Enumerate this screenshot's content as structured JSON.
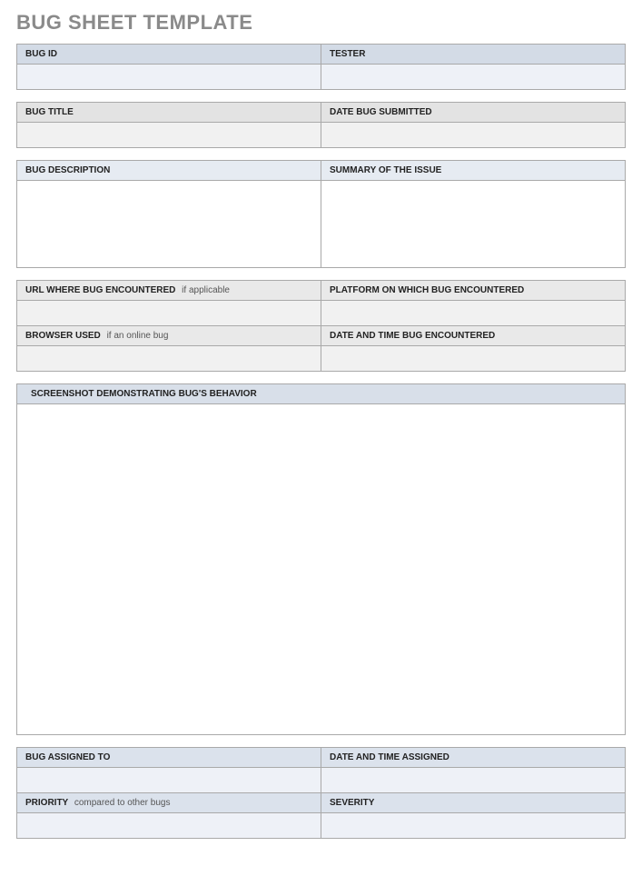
{
  "title": "BUG SHEET TEMPLATE",
  "sec1": {
    "left": "BUG ID",
    "right": "TESTER"
  },
  "sec2": {
    "left": "BUG TITLE",
    "right": "DATE BUG SUBMITTED"
  },
  "sec3": {
    "left": "BUG DESCRIPTION",
    "right": "SUMMARY OF THE ISSUE"
  },
  "sec4": {
    "r1l": "URL WHERE BUG ENCOUNTERED",
    "r1l_hint": "if applicable",
    "r1r": "PLATFORM ON WHICH BUG ENCOUNTERED",
    "r2l": "BROWSER USED",
    "r2l_hint": "if an online bug",
    "r2r": "DATE AND TIME BUG ENCOUNTERED"
  },
  "sec5": {
    "header": "SCREENSHOT DEMONSTRATING BUG'S BEHAVIOR"
  },
  "sec6": {
    "r1l": "BUG ASSIGNED TO",
    "r1r": "DATE AND TIME ASSIGNED",
    "r2l": "PRIORITY",
    "r2l_hint": "compared to other bugs",
    "r2r": "SEVERITY"
  }
}
